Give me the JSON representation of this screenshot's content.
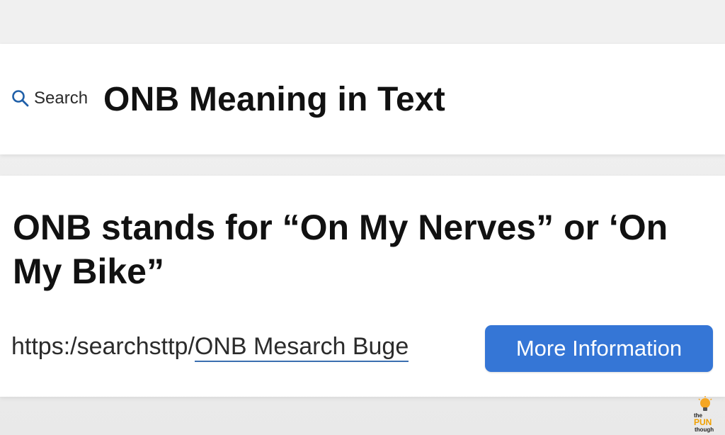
{
  "search": {
    "label": "Search",
    "query_title": "ONB Meaning in Text"
  },
  "result": {
    "heading": "ONB stands for “On My Nerves” or ‘On My Bike”",
    "url_prefix": "https:/searchsttp/",
    "url_link": "ONB Mesarch Buge",
    "button_label": "More Information"
  },
  "watermark": {
    "the": "the",
    "pun": "PUN",
    "though": "though"
  },
  "colors": {
    "accent": "#3576d6",
    "link_underline": "#3b6fb0",
    "watermark_accent": "#f0a000"
  },
  "icons": {
    "search": "search-icon",
    "watermark": "lightbulb-icon"
  }
}
